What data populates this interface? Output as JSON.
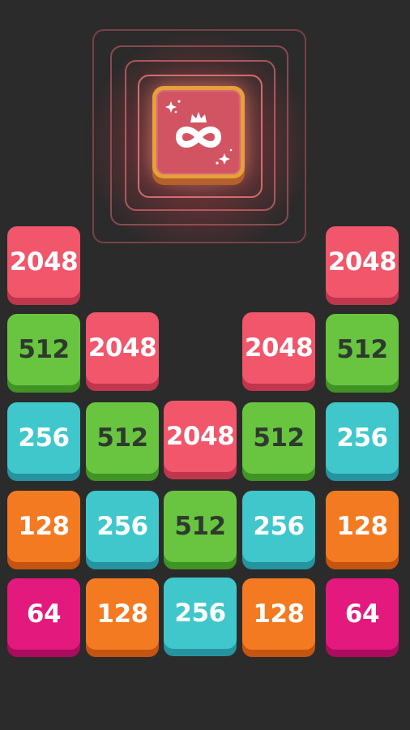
{
  "special_tile": {
    "icon": "crowned-infinity-icon",
    "colors": {
      "face": "#d25462",
      "rim": "#e6a03c",
      "glow": "#ff7878"
    }
  },
  "tile_colors": {
    "2048": "#f1566b",
    "512": "#69c540",
    "256": "#3fc7cc",
    "128": "#f47a22",
    "64": "#e3197e"
  },
  "columns": [
    {
      "tiles": [
        "2048",
        "512",
        "256",
        "128",
        "64"
      ]
    },
    {
      "tiles": [
        "2048",
        "256",
        "128"
      ]
    },
    {
      "tiles": [
        "2048",
        "512",
        "256"
      ]
    },
    {
      "tiles": [
        "2048",
        "512",
        "256",
        "128"
      ]
    },
    {
      "tiles": [
        "2048",
        "512",
        "256",
        "128",
        "64"
      ]
    }
  ]
}
